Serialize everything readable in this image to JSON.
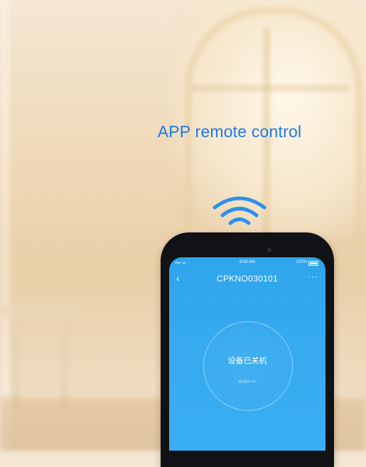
{
  "headline": "APP remote control",
  "phone": {
    "status_bar": {
      "signal": "•••• ᯤ",
      "time": "6:08 AM",
      "battery": "100%"
    },
    "nav": {
      "back_icon": "‹",
      "title": "CPKNO030101",
      "more_icon": "···"
    },
    "device": {
      "status": "设备已关机",
      "sub": "滤芯剩余 93%"
    }
  },
  "colors": {
    "accent": "#1e78e6",
    "screen": "#37aaf0",
    "phone_body": "#101215"
  },
  "icons": [
    "wifi-signal-icon",
    "back-arrow-icon",
    "more-options-icon",
    "battery-icon"
  ]
}
